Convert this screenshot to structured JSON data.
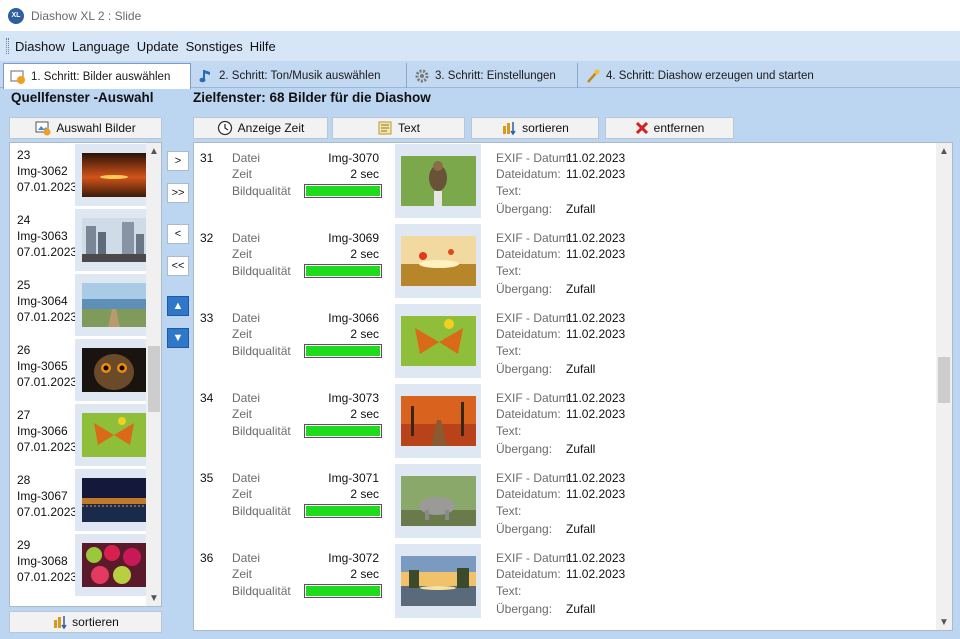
{
  "window": {
    "app_logo_text": "XL",
    "title": "Diashow XL 2 : Slide"
  },
  "menu": [
    "Diashow",
    "Language",
    "Update",
    "Sonstiges",
    "Hilfe"
  ],
  "tabs": [
    {
      "label": "1. Schritt: Bilder auswählen",
      "icon": "image-select-icon",
      "active": true
    },
    {
      "label": "2. Schritt: Ton/Musik auswählen",
      "icon": "music-note-icon",
      "active": false
    },
    {
      "label": "3. Schritt: Einstellungen",
      "icon": "settings-gear-icon",
      "active": false
    },
    {
      "label": "4. Schritt: Diashow erzeugen und starten",
      "icon": "magic-wand-icon",
      "active": false
    }
  ],
  "source": {
    "title": "Quellfenster -Auswahl",
    "select_button": "Auswahl Bilder",
    "sort_button": "sortieren",
    "items": [
      {
        "num": "23",
        "name": "Img-3062",
        "date": "07.01.2023",
        "thumb": "sunset"
      },
      {
        "num": "24",
        "name": "Img-3063",
        "date": "07.01.2023",
        "thumb": "city"
      },
      {
        "num": "25",
        "name": "Img-3064",
        "date": "07.01.2023",
        "thumb": "boardwalk"
      },
      {
        "num": "26",
        "name": "Img-3065",
        "date": "07.01.2023",
        "thumb": "owl"
      },
      {
        "num": "27",
        "name": "Img-3066",
        "date": "07.01.2023",
        "thumb": "butterfly"
      },
      {
        "num": "28",
        "name": "Img-3067",
        "date": "07.01.2023",
        "thumb": "night-city"
      },
      {
        "num": "29",
        "name": "Img-3068",
        "date": "07.01.2023",
        "thumb": "fruits"
      }
    ]
  },
  "transfer_buttons": [
    {
      "label": ">",
      "name": "add-one-button"
    },
    {
      "label": ">>",
      "name": "add-all-button"
    },
    {
      "label": "<",
      "name": "remove-one-button"
    },
    {
      "label": "<<",
      "name": "remove-all-button"
    },
    {
      "label": "▲",
      "name": "move-up-button"
    },
    {
      "label": "▼",
      "name": "move-down-button"
    }
  ],
  "target": {
    "title": "Zielfenster: 68 Bilder für die Diashow",
    "toolbar": {
      "time": "Anzeige Zeit",
      "text": "Text",
      "sort": "sortieren",
      "remove": "entfernen"
    },
    "labels": {
      "file": "Datei",
      "time": "Zeit",
      "quality": "Bildqualität",
      "exif": "EXIF - Datum:",
      "filedate": "Dateidatum:",
      "text": "Text:",
      "transition": "Übergang:"
    },
    "items": [
      {
        "num": "31",
        "file": "Img-3070",
        "time": "2 sec",
        "quality": 1.0,
        "exif": "11.02.2023",
        "filedate": "11.02.2023",
        "text": "",
        "transition": "Zufall",
        "thumb": "falcon"
      },
      {
        "num": "32",
        "file": "Img-3069",
        "time": "2 sec",
        "quality": 1.0,
        "exif": "11.02.2023",
        "filedate": "11.02.2023",
        "text": "",
        "transition": "Zufall",
        "thumb": "field"
      },
      {
        "num": "33",
        "file": "Img-3066",
        "time": "2 sec",
        "quality": 1.0,
        "exif": "11.02.2023",
        "filedate": "11.02.2023",
        "text": "",
        "transition": "Zufall",
        "thumb": "butterfly"
      },
      {
        "num": "34",
        "file": "Img-3073",
        "time": "2 sec",
        "quality": 1.0,
        "exif": "11.02.2023",
        "filedate": "11.02.2023",
        "text": "",
        "transition": "Zufall",
        "thumb": "autumn"
      },
      {
        "num": "35",
        "file": "Img-3071",
        "time": "2 sec",
        "quality": 1.0,
        "exif": "11.02.2023",
        "filedate": "11.02.2023",
        "text": "",
        "transition": "Zufall",
        "thumb": "rhino"
      },
      {
        "num": "36",
        "file": "Img-3072",
        "time": "2 sec",
        "quality": 1.0,
        "exif": "11.02.2023",
        "filedate": "11.02.2023",
        "text": "",
        "transition": "Zufall",
        "thumb": "lake"
      }
    ]
  },
  "colors": {
    "quality_bar": "#1cdc1c",
    "window_bg": "#bcd6f1",
    "remove_icon": "#d42020"
  }
}
